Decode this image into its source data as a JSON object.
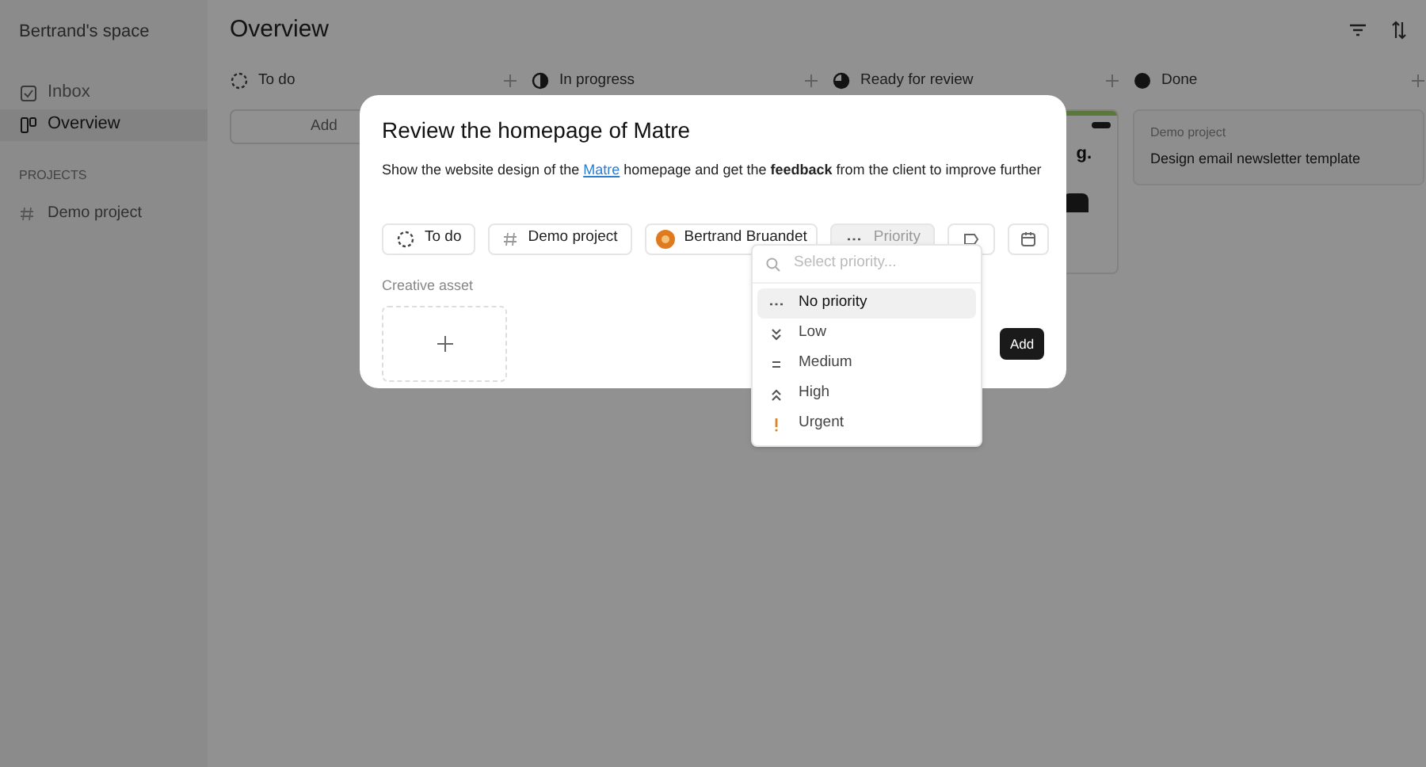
{
  "sidebar": {
    "workspace": "Bertrand's space",
    "items": [
      {
        "label": "Inbox",
        "kind": "inbox",
        "selected": false
      },
      {
        "label": "Overview",
        "kind": "board",
        "selected": true
      }
    ],
    "projects_heading": "PROJECTS",
    "projects": [
      {
        "label": "Demo project"
      }
    ]
  },
  "header": {
    "title": "Overview"
  },
  "columns": [
    {
      "title": "To do",
      "kind": "todo",
      "add_button": "Add"
    },
    {
      "title": "In progress",
      "kind": "progress"
    },
    {
      "title": "Ready for review",
      "kind": "review",
      "card_fragment": "g."
    },
    {
      "title": "Done",
      "kind": "done",
      "card": {
        "project": "Demo project",
        "title": "Design email newsletter template"
      }
    }
  ],
  "dialog": {
    "title": "Review the homepage of Matre",
    "description_start": "Show the website design of the",
    "link": "Matre",
    "description_end": "homepage and get the **feedback** from the client to improve further",
    "chips": [
      {
        "label": "To do",
        "kind": "status"
      },
      {
        "label": "Demo project",
        "kind": "project"
      },
      {
        "label": "Bertrand Bruandet",
        "kind": "assignee"
      },
      {
        "label": "Priority",
        "kind": "priority"
      },
      {
        "kind": "label"
      },
      {
        "kind": "date"
      }
    ],
    "asset_label": "Creative asset",
    "add_button": "Add"
  },
  "priority_menu": {
    "placeholder": "Select priority...",
    "options": [
      {
        "label": "No priority",
        "kind": "none",
        "selected": true
      },
      {
        "label": "Low",
        "kind": "low",
        "selected": false
      },
      {
        "label": "Medium",
        "kind": "medium",
        "selected": false
      },
      {
        "label": "High",
        "kind": "high",
        "selected": false
      },
      {
        "label": "Urgent",
        "kind": "urgent",
        "selected": false
      }
    ]
  }
}
